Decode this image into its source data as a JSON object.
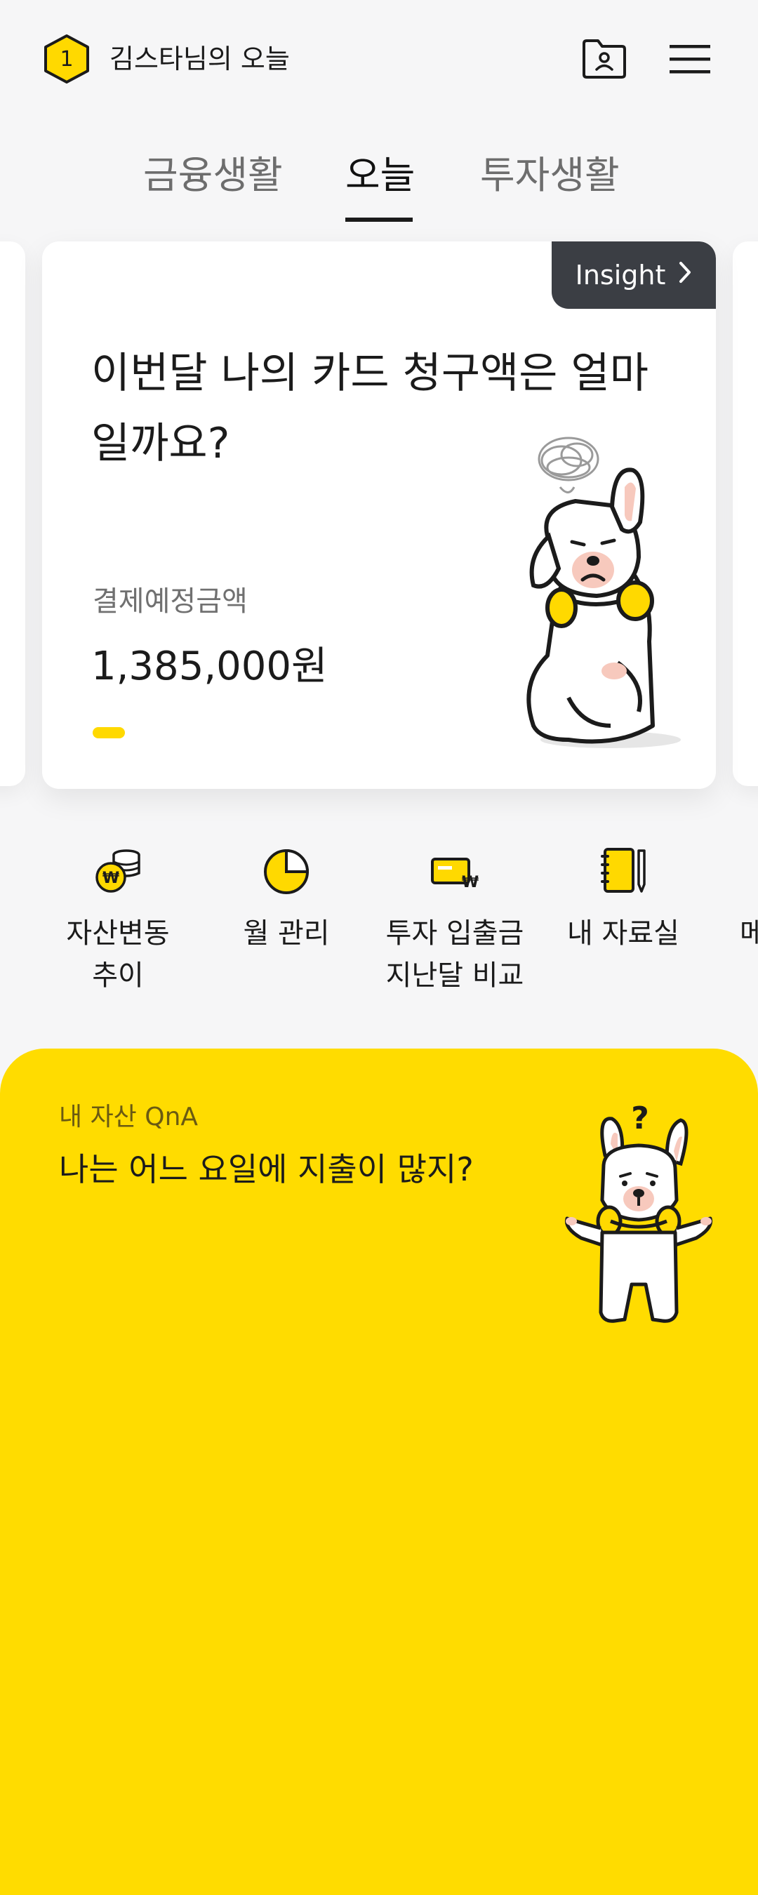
{
  "header": {
    "level": "1",
    "title": "김스타님의 오늘",
    "icons": [
      "folder-user-icon",
      "hamburger-menu-icon"
    ]
  },
  "tabs": [
    {
      "label": "금융생활",
      "active": false
    },
    {
      "label": "오늘",
      "active": true
    },
    {
      "label": "투자생활",
      "active": false
    }
  ],
  "card": {
    "insight_label": "Insight",
    "question": "이번달 나의 카드 청구액은 얼마일까요?",
    "amount_label": "결제예정금액",
    "amount_value": "1,385,000원"
  },
  "quick_menu": [
    {
      "icon": "asset-coins-icon",
      "label": "자산변동\n추이"
    },
    {
      "icon": "pie-chart-icon",
      "label": "월 관리"
    },
    {
      "icon": "card-won-icon",
      "label": "투자 입출금\n지난달 비교"
    },
    {
      "icon": "notebook-icon",
      "label": "내 자료실"
    },
    {
      "icon": "menu-icon",
      "label": "메"
    }
  ],
  "qna": {
    "label": "내 자산 QnA",
    "question": "나는 어느 요일에 지출이 많지?"
  },
  "colors": {
    "accent": "#ffdc00",
    "insight_bg": "#3b3e44",
    "background": "#f6f6f7"
  }
}
